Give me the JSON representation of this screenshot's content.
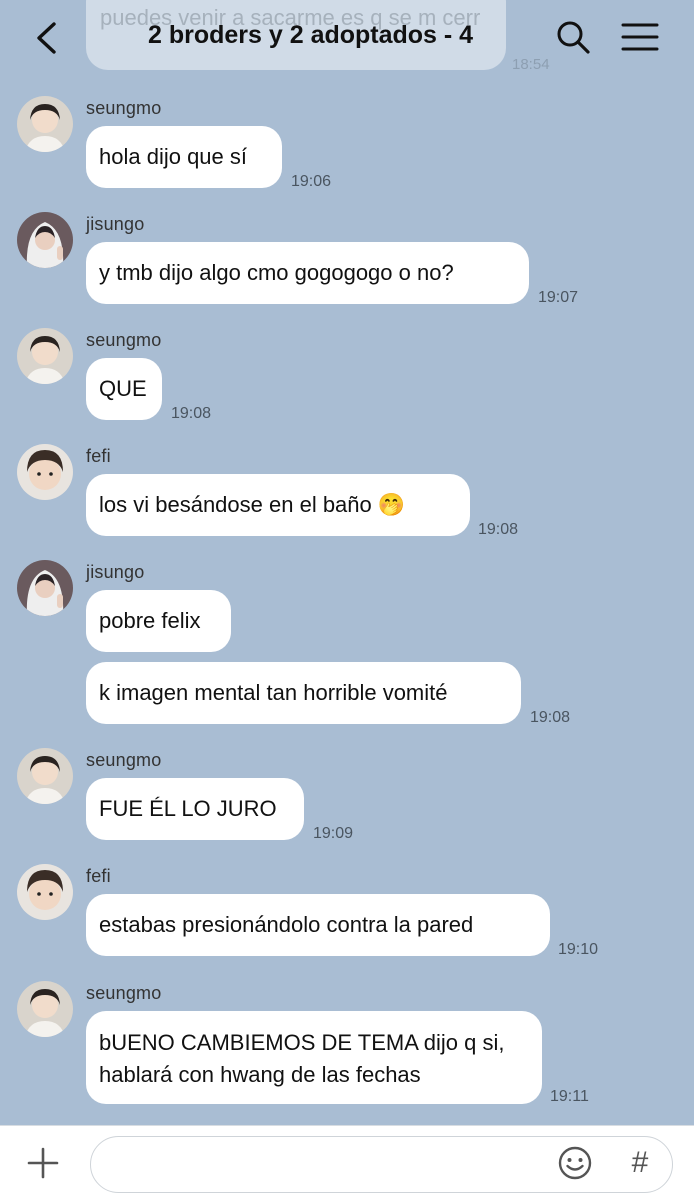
{
  "header": {
    "title": "2 broders y 2 adoptados - 4",
    "back_icon": "chevron-left-icon",
    "search_icon": "search-icon",
    "menu_icon": "hamburger-menu-icon"
  },
  "ghost": {
    "text": "puedes venir a sacarme es q se m cerr",
    "time": "18:54"
  },
  "messages": [
    {
      "sender": "seungmo",
      "bubbles": [
        "hola dijo que sí"
      ],
      "time": "19:06"
    },
    {
      "sender": "jisungo",
      "bubbles": [
        "y tmb dijo algo cmo gogogogo o no?"
      ],
      "time": "19:07"
    },
    {
      "sender": "seungmo",
      "bubbles": [
        "QUE"
      ],
      "time": "19:08"
    },
    {
      "sender": "fefi",
      "bubbles": [
        "los vi besándose en el baño 🤭"
      ],
      "time": "19:08"
    },
    {
      "sender": "jisungo",
      "bubbles": [
        "pobre felix",
        "k imagen mental tan horrible vomité"
      ],
      "time": "19:08"
    },
    {
      "sender": "seungmo",
      "bubbles": [
        "FUE ÉL LO JURO"
      ],
      "time": "19:09"
    },
    {
      "sender": "fefi",
      "bubbles": [
        "estabas presionándolo contra la pared"
      ],
      "time": "19:10"
    },
    {
      "sender": "seungmo",
      "bubbles": [
        "bUENO CAMBIEMOS DE TEMA dijo q si, hablará con hwang de las fechas"
      ],
      "time": "19:11"
    }
  ],
  "input_bar": {
    "plus_icon": "plus-icon",
    "placeholder": "",
    "emoji_icon": "emoji-icon",
    "hash_label": "#"
  },
  "colors": {
    "background": "#a9bdd3",
    "bubble": "#ffffff"
  }
}
